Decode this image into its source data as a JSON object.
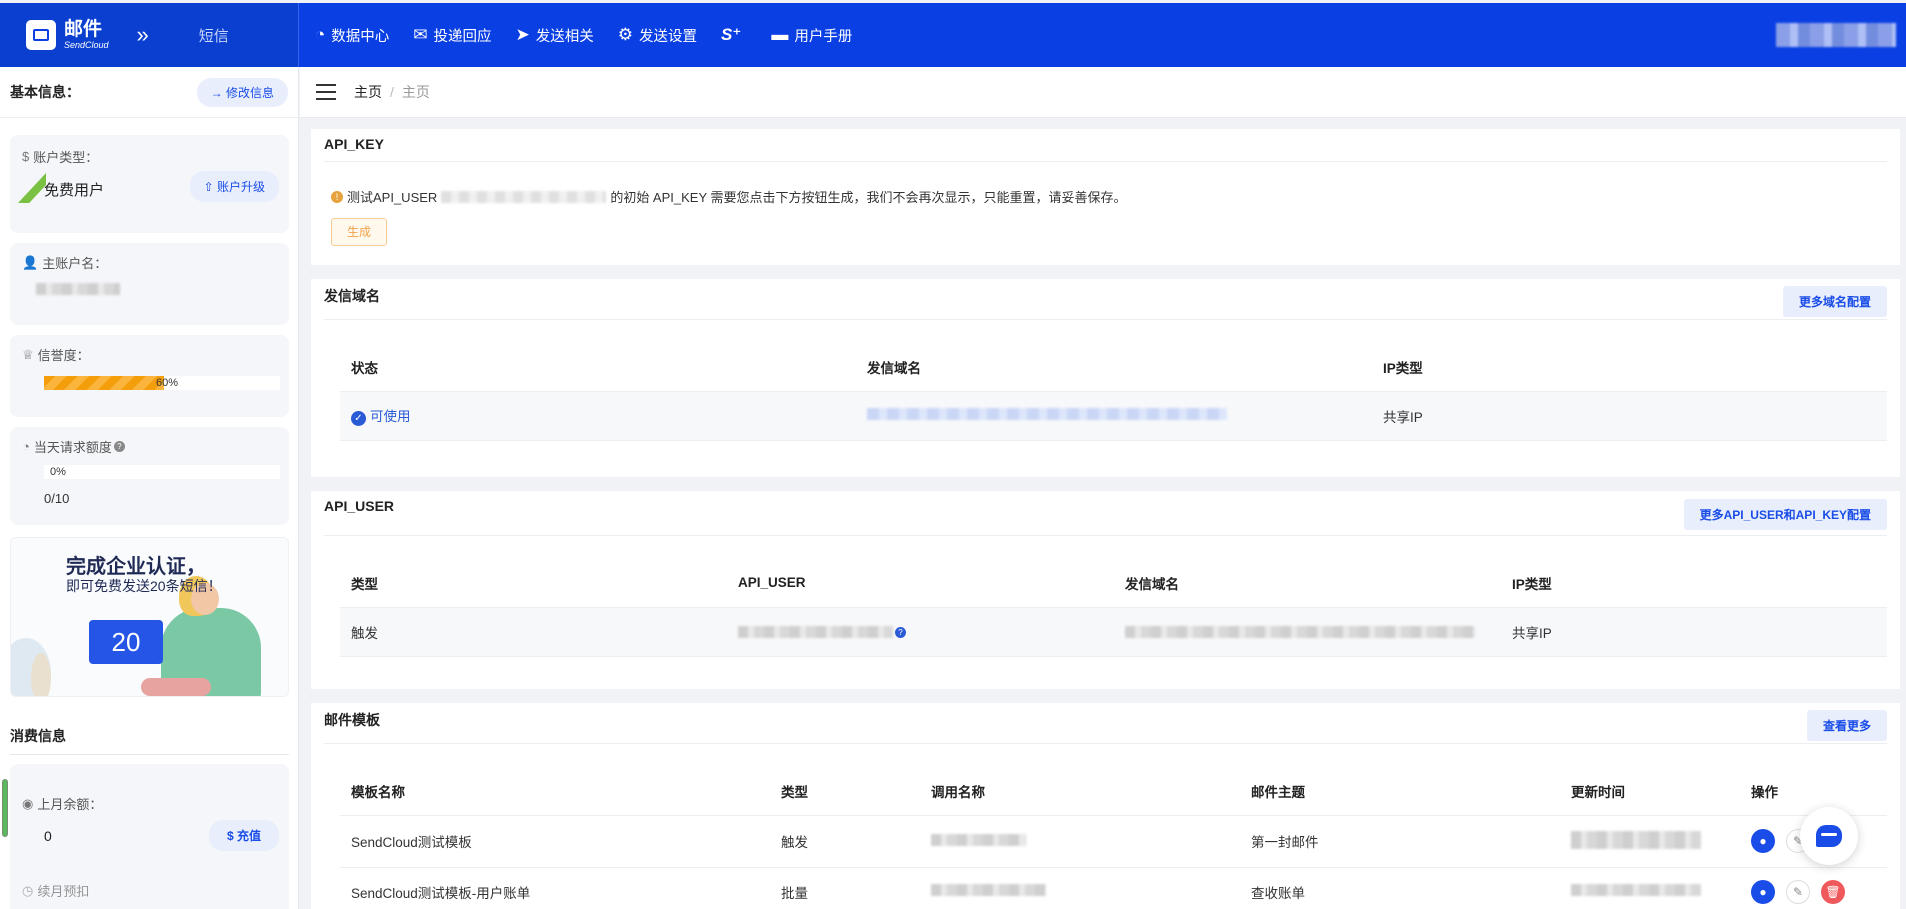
{
  "topbar": {
    "brand_title": "邮件",
    "brand_subtitle": "SendCloud",
    "expand_icon": "»",
    "sms_label": "短信",
    "nav": [
      {
        "icon": "pie-chart-icon",
        "glyph": "◔",
        "label": "数据中心"
      },
      {
        "icon": "mail-reply-icon",
        "glyph": "✉",
        "label": "投递回应"
      },
      {
        "icon": "paper-plane-icon",
        "glyph": "➤",
        "label": "发送相关"
      },
      {
        "icon": "gear-icon",
        "glyph": "⚙",
        "label": "发送设置"
      },
      {
        "icon": "s-plus-icon",
        "glyph": "S⁺",
        "label": ""
      },
      {
        "icon": "folder-icon",
        "glyph": "▬",
        "label": "用户手册"
      }
    ]
  },
  "sidebar": {
    "title": "基本信息：",
    "edit_button": "→ 修改信息",
    "account_type_label": "账户类型：",
    "account_type_value": "免费用户",
    "upgrade_button": "账户升级",
    "main_account_label": "主账户名：",
    "credit_label": "信誉度：",
    "credit_percent": 60,
    "credit_text": "60%",
    "quota_label": "当天请求额度",
    "quota_percent": 0,
    "quota_text": "0%",
    "quota_value": "0/10",
    "banner_line1": "完成企业认证，",
    "banner_line2": "即可免费发送20条短信！",
    "banner_number": "20",
    "consumption_title": "消费信息",
    "last_month_label": "上月余额：",
    "last_month_value": "0",
    "recharge_button": "充值",
    "next_label": "续月预扣"
  },
  "breadcrumb": {
    "home": "主页",
    "current": "主页"
  },
  "api_key": {
    "title": "API_KEY",
    "notice_prefix": "测试API_USER",
    "notice_suffix": "的初始 API_KEY 需要您点击下方按钮生成，我们不会再次显示，只能重置，请妥善保存。",
    "generate_button": "生成"
  },
  "domains": {
    "title": "发信域名",
    "more_button": "更多域名配置",
    "headers": [
      "状态",
      "发信域名",
      "IP类型"
    ],
    "rows": [
      {
        "status": "可使用",
        "ip_type": "共享IP"
      }
    ]
  },
  "api_user": {
    "title": "API_USER",
    "more_button": "更多API_USER和API_KEY配置",
    "headers": [
      "类型",
      "API_USER",
      "发信域名",
      "IP类型"
    ],
    "rows": [
      {
        "type": "触发",
        "ip_type": "共享IP"
      }
    ]
  },
  "templates": {
    "title": "邮件模板",
    "more_button": "查看更多",
    "headers": [
      "模板名称",
      "类型",
      "调用名称",
      "邮件主题",
      "更新时间",
      "操作"
    ],
    "rows": [
      {
        "name": "SendCloud测试模板",
        "type": "触发",
        "subject": "第一封邮件"
      },
      {
        "name": "SendCloud测试模板-用户账单",
        "type": "批量",
        "subject": "查收账单"
      }
    ]
  },
  "colors": {
    "primary": "#0a3fe4",
    "accent": "#1a4de8",
    "warning": "#f59e0b",
    "danger": "#f0595b"
  }
}
